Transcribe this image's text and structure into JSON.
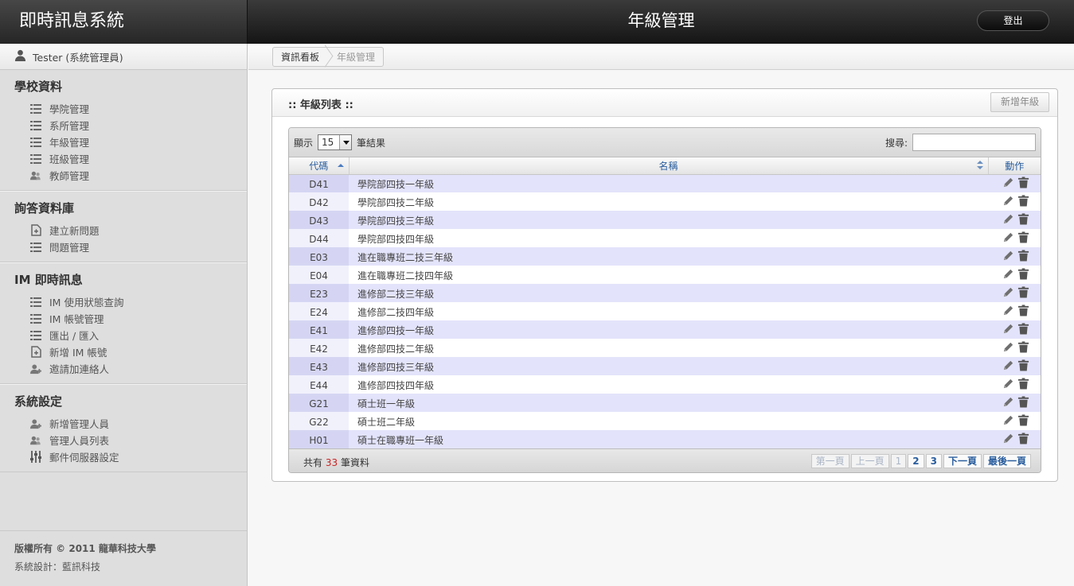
{
  "header": {
    "app_title": "即時訊息系統",
    "page_title": "年級管理",
    "logout_label": "登出"
  },
  "user": {
    "label": "Tester (系統管理員)"
  },
  "sidebar": {
    "groups": [
      {
        "title": "學校資料",
        "items": [
          {
            "label": "學院管理",
            "icon": "list-icon"
          },
          {
            "label": "系所管理",
            "icon": "list-icon"
          },
          {
            "label": "年級管理",
            "icon": "list-icon"
          },
          {
            "label": "班級管理",
            "icon": "list-icon"
          },
          {
            "label": "教師管理",
            "icon": "users-icon"
          }
        ]
      },
      {
        "title": "詢答資料庫",
        "items": [
          {
            "label": "建立新問題",
            "icon": "new-document-icon"
          },
          {
            "label": "問題管理",
            "icon": "list-icon"
          }
        ]
      },
      {
        "title": "IM 即時訊息",
        "items": [
          {
            "label": "IM 使用狀態查詢",
            "icon": "list-icon"
          },
          {
            "label": "IM 帳號管理",
            "icon": "list-icon"
          },
          {
            "label": "匯出 / 匯入",
            "icon": "list-icon"
          },
          {
            "label": "新增 IM 帳號",
            "icon": "new-document-icon"
          },
          {
            "label": "邀請加連絡人",
            "icon": "add-user-icon"
          }
        ]
      },
      {
        "title": "系統設定",
        "items": [
          {
            "label": "新增管理人員",
            "icon": "add-user-icon"
          },
          {
            "label": "管理人員列表",
            "icon": "users-icon"
          },
          {
            "label": "郵件伺服器設定",
            "icon": "sliders-icon"
          }
        ]
      }
    ]
  },
  "footer": {
    "copyright": "版權所有 © 2011 龍華科技大學",
    "design": "系統設計：藍訊科技"
  },
  "breadcrumb": {
    "home": "資訊看板",
    "current": "年級管理"
  },
  "panel": {
    "title": ":: 年級列表 ::",
    "add_label": "新增年級"
  },
  "table": {
    "show_prefix": "顯示",
    "page_size": "15",
    "show_suffix": "筆結果",
    "search_label": "搜尋:",
    "search_value": "",
    "columns": {
      "code": "代碼",
      "name": "名稱",
      "action": "動作"
    },
    "rows": [
      {
        "code": "D41",
        "name": "學院部四技一年級"
      },
      {
        "code": "D42",
        "name": "學院部四技二年級"
      },
      {
        "code": "D43",
        "name": "學院部四技三年級"
      },
      {
        "code": "D44",
        "name": "學院部四技四年級"
      },
      {
        "code": "E03",
        "name": "進在職專班二技三年級"
      },
      {
        "code": "E04",
        "name": "進在職專班二技四年級"
      },
      {
        "code": "E23",
        "name": "進修部二技三年級"
      },
      {
        "code": "E24",
        "name": "進修部二技四年級"
      },
      {
        "code": "E41",
        "name": "進修部四技一年級"
      },
      {
        "code": "E42",
        "name": "進修部四技二年級"
      },
      {
        "code": "E43",
        "name": "進修部四技三年級"
      },
      {
        "code": "E44",
        "name": "進修部四技四年級"
      },
      {
        "code": "G21",
        "name": "碩士班一年級"
      },
      {
        "code": "G22",
        "name": "碩士班二年級"
      },
      {
        "code": "H01",
        "name": "碩士在職專班一年級"
      }
    ],
    "total_prefix": "共有",
    "total_count": "33",
    "total_suffix": "筆資料",
    "pager": {
      "first": "第一頁",
      "prev": "上一頁",
      "pages": [
        "1",
        "2",
        "3"
      ],
      "current_page": "1",
      "next": "下一頁",
      "last": "最後一頁"
    }
  },
  "colors": {
    "topbar": "#1e1e1e",
    "sidebar": "#dedede",
    "link": "#2a5e9e",
    "row_alt": "#e3e3fb",
    "count": "#cc2222"
  }
}
